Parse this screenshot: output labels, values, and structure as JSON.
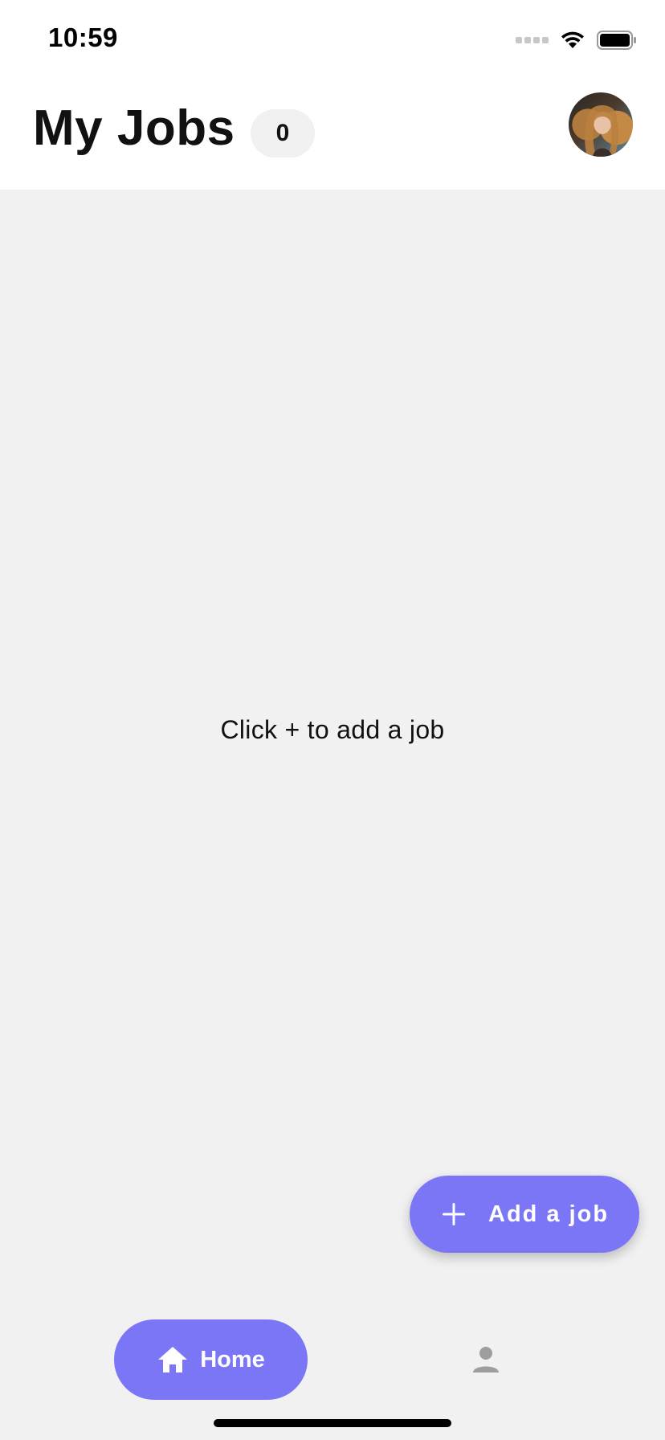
{
  "status_bar": {
    "time": "10:59",
    "icons": [
      "cellular-signal-icon",
      "wifi-icon",
      "battery-icon"
    ]
  },
  "header": {
    "title": "My Jobs",
    "job_count": "0",
    "avatar_icon": "user-avatar-photo"
  },
  "empty_state": {
    "message": "Click + to add a job"
  },
  "fab": {
    "icon": "plus-icon",
    "label": "Add a job"
  },
  "bottom_nav": {
    "items": [
      {
        "icon": "home-icon",
        "label": "Home",
        "active": true
      },
      {
        "icon": "person-icon",
        "label": "",
        "active": false
      }
    ]
  },
  "colors": {
    "accent": "#7b76f5",
    "background": "#f1f1f2",
    "surface": "#ffffff",
    "inactive_icon": "#9e9e9e"
  }
}
